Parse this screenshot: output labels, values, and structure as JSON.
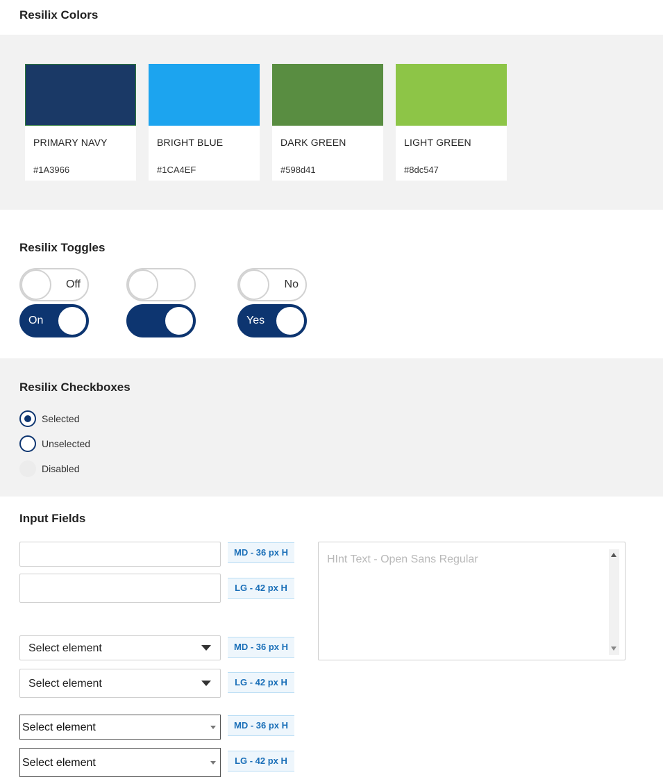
{
  "colors": {
    "title": "Resilix Colors",
    "swatches": [
      {
        "name": "PRIMARY NAVY",
        "hex": "#1A3966"
      },
      {
        "name": "BRIGHT BLUE",
        "hex": "#1CA4EF"
      },
      {
        "name": "DARK GREEN",
        "hex": "#598d41"
      },
      {
        "name": "LIGHT GREEN",
        "hex": "#8dc547"
      }
    ]
  },
  "toggles": {
    "title": "Resilix Toggles",
    "items": [
      {
        "off_label": "Off",
        "on_label": "On"
      },
      {
        "off_label": "",
        "on_label": ""
      },
      {
        "off_label": "No",
        "on_label": "Yes"
      }
    ],
    "accent": "#0d3570"
  },
  "checkboxes": {
    "title": "Resilix Checkboxes",
    "items": [
      {
        "label": "Selected",
        "state": "selected"
      },
      {
        "label": "Unselected",
        "state": "unselected"
      },
      {
        "label": "Disabled",
        "state": "disabled"
      }
    ]
  },
  "inputs": {
    "title": "Input Fields",
    "md_tag": "MD - 36 px H",
    "lg_tag": "LG - 42 px H",
    "select_label": "Select element",
    "textarea_hint": "HInt Text - Open Sans Regular"
  }
}
